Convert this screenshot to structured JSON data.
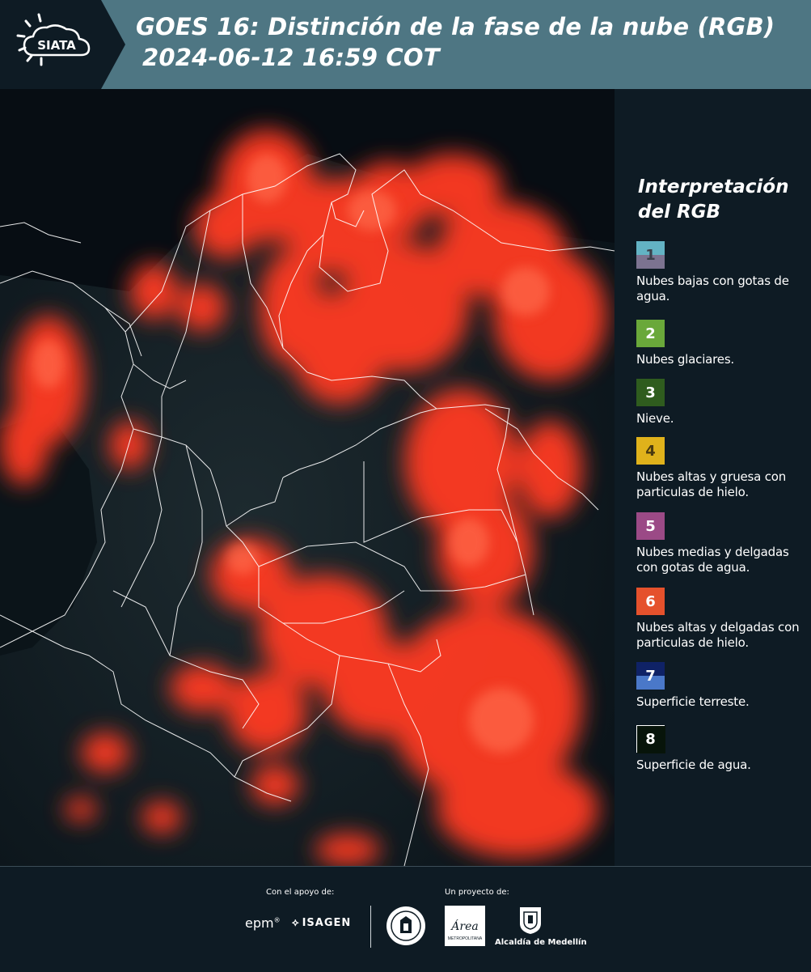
{
  "header": {
    "logo_text": "SIATA",
    "title_line1": "GOES 16: Distinción de la fase de la nube (RGB)",
    "title_line2": "2024-06-12 16:59 COT"
  },
  "legend": {
    "title": "Interpretación del RGB",
    "items": [
      {
        "num": "1",
        "label": "Nubes bajas con gotas de agua.",
        "top_color": "#63b3c4",
        "bottom_color": "#7c7390",
        "num_color": "#3a3f4a"
      },
      {
        "num": "2",
        "label": "Nubes glaciares.",
        "top_color": "#6aa83a",
        "bottom_color": "#6aa83a",
        "num_color": "#ffffff"
      },
      {
        "num": "3",
        "label": "Nieve.",
        "top_color": "#2f5c1e",
        "bottom_color": "#2f5c1e",
        "num_color": "#ffffff"
      },
      {
        "num": "4",
        "label": "Nubes altas y gruesa con particulas de hielo.",
        "top_color": "#e0b21b",
        "bottom_color": "#e0b21b",
        "num_color": "#4a3a10"
      },
      {
        "num": "5",
        "label": "Nubes medias y delgadas con gotas de agua.",
        "top_color": "#9b4a86",
        "bottom_color": "#9b4a86",
        "num_color": "#ffffff"
      },
      {
        "num": "6",
        "label": "Nubes altas y delgadas con particulas de hielo.",
        "top_color": "#e5512c",
        "bottom_color": "#e5512c",
        "num_color": "#ffffff"
      },
      {
        "num": "7",
        "label": "Superficie terreste.",
        "top_color": "#0f2266",
        "bottom_color": "#4a78c9",
        "num_color": "#ffffff"
      },
      {
        "num": "8",
        "label": "Superficie de agua.",
        "top_color": "#07140a",
        "bottom_color": "#07140a",
        "num_color": "#ffffff"
      }
    ]
  },
  "footer": {
    "support_label": "Con el apoyo de:",
    "project_label": "Un proyecto de:",
    "epm": "epm",
    "epm_mark": "®",
    "isagen": "ISAGEN",
    "area_text": "Área",
    "area_sub": "METROPOLITANA",
    "alcaldia": "Alcaldía de Medellín"
  },
  "colors": {
    "header_bg": "#4e7683",
    "background": "#0e1b24",
    "cloud": "#ff3a22"
  }
}
